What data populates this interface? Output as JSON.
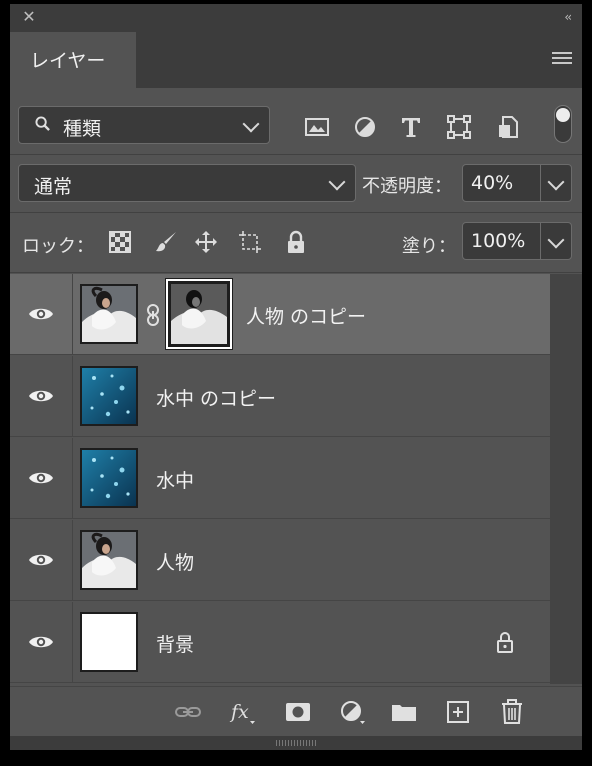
{
  "panel": {
    "title": "レイヤー"
  },
  "filter": {
    "kind_label": "種類",
    "filter_icons": [
      "image-filter-icon",
      "adjustment-filter-icon",
      "type-filter-icon",
      "shape-filter-icon",
      "smart-object-filter-icon"
    ]
  },
  "blend": {
    "mode": "通常",
    "opacity_label": "不透明度：",
    "opacity_value": "40%"
  },
  "lock": {
    "label": "ロック：",
    "fill_label": "塗り：",
    "fill_value": "100%"
  },
  "layers": [
    {
      "name": "人物 のコピー",
      "thumb": "person",
      "has_mask": true,
      "selected": true,
      "visible": true
    },
    {
      "name": "水中 のコピー",
      "thumb": "water",
      "has_mask": false,
      "selected": false,
      "visible": true
    },
    {
      "name": "水中",
      "thumb": "water",
      "has_mask": false,
      "selected": false,
      "visible": true
    },
    {
      "name": "人物",
      "thumb": "person",
      "has_mask": false,
      "selected": false,
      "visible": true
    },
    {
      "name": "背景",
      "thumb": "white",
      "has_mask": false,
      "selected": false,
      "visible": true,
      "locked": true
    }
  ],
  "colors": {
    "panel_bg": "#535353",
    "selected_row": "#6a6a6a",
    "field_bg": "#3a3a3a"
  }
}
